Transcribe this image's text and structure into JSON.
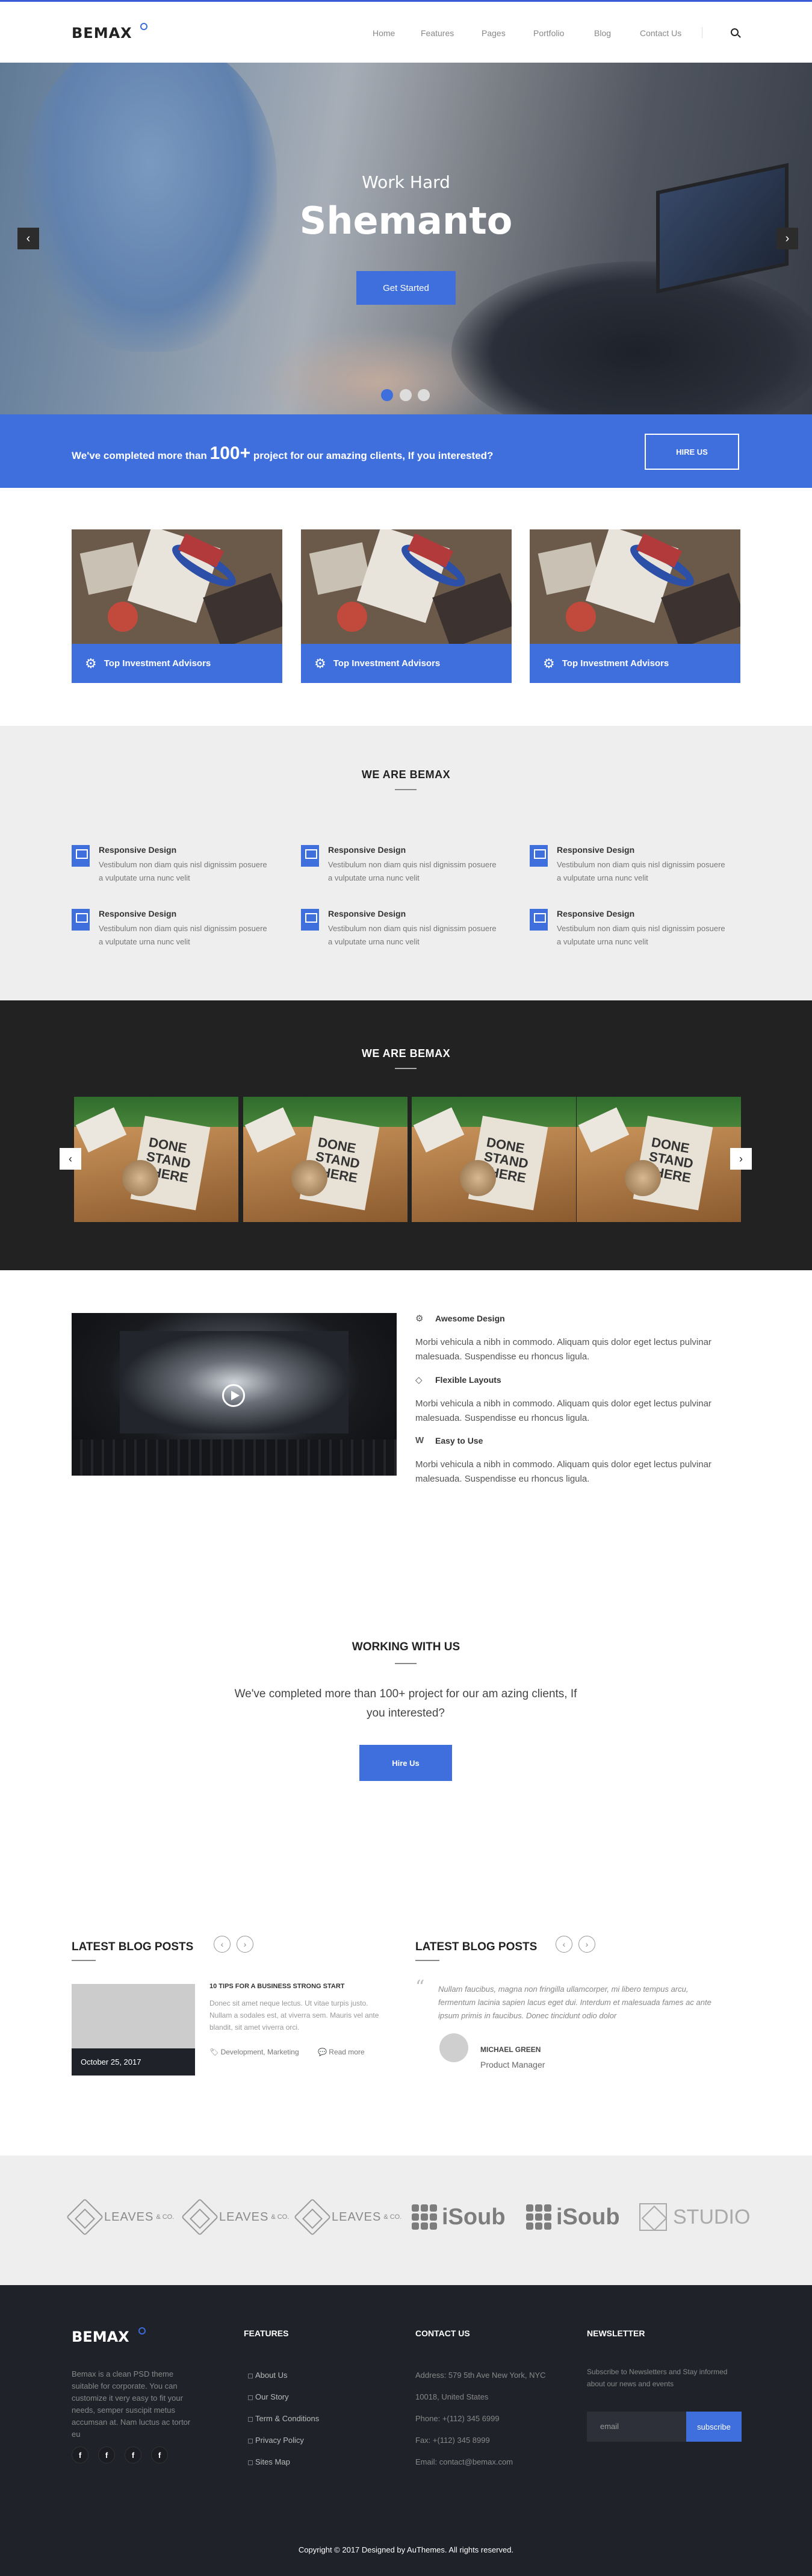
{
  "brand": {
    "logo": "BEMAX",
    "accent": "#3f6fdc"
  },
  "nav": {
    "items": [
      "Home",
      "Features",
      "Pages",
      "Portfolio",
      "Blog",
      "Contact Us"
    ]
  },
  "hero": {
    "subtitle": "Work Hard",
    "title": "Shemanto",
    "button": "Get Started",
    "prev": "‹",
    "next": "›"
  },
  "cta": {
    "text_before": "We've completed more than ",
    "number": "100+",
    "text_after": " project for our amazing clients, If you interested?",
    "button": "HIRE US"
  },
  "cards": [
    {
      "title": "Top Investment Advisors"
    },
    {
      "title": "Top Investment Advisors"
    },
    {
      "title": "Top Investment Advisors"
    }
  ],
  "features": {
    "title": "WE ARE BEMAX",
    "items": [
      {
        "title": "Responsive Design",
        "text": "Vestibulum non diam quis nisl dignissim posuere a vulputate urna nunc velit"
      },
      {
        "title": "Responsive Design",
        "text": "Vestibulum non diam quis nisl dignissim posuere a vulputate urna nunc velit"
      },
      {
        "title": "Responsive Design",
        "text": "Vestibulum non diam quis nisl dignissim posuere a vulputate urna nunc velit"
      },
      {
        "title": "Responsive Design",
        "text": "Vestibulum non diam quis nisl dignissim posuere a vulputate urna nunc velit"
      },
      {
        "title": "Responsive Design",
        "text": "Vestibulum non diam quis nisl dignissim posuere a vulputate urna nunc velit"
      },
      {
        "title": "Responsive Design",
        "text": "Vestibulum non diam quis nisl dignissim posuere a vulputate urna nunc velit"
      }
    ]
  },
  "gallery": {
    "title": "WE ARE BEMAX",
    "book_text": "DONE STAND THERE",
    "prev": "‹",
    "next": "›"
  },
  "video_features": [
    {
      "title": "Awesome Design",
      "icon": "gears-icon",
      "text": "Morbi vehicula a nibh in commodo. Aliquam quis dolor eget lectus pulvinar malesuada. Suspendisse eu rhoncus ligula."
    },
    {
      "title": "Flexible Layouts",
      "icon": "diamond-icon",
      "text": "Morbi vehicula a nibh in commodo. Aliquam quis dolor eget lectus pulvinar malesuada. Suspendisse eu rhoncus ligula."
    },
    {
      "title": "Easy to Use",
      "icon": "w-icon",
      "text": "Morbi vehicula a nibh in commodo. Aliquam quis dolor eget lectus pulvinar malesuada. Suspendisse eu rhoncus ligula."
    }
  ],
  "working": {
    "title": "WORKING WITH US",
    "text": "We've completed more than 100+ project for our am azing clients, If you interested?",
    "button": "Hire Us"
  },
  "blog": {
    "heading_left": "LATEST BLOG POSTS",
    "heading_right": "LATEST BLOG POSTS",
    "post": {
      "date": "October 25, 2017",
      "title": "10 TIPS FOR A BUSINESS STRONG START",
      "text": "Donec sit amet neque lectus. Ut vitae turpis justo. Nullam a sodales est, at viverra sem. Mauris vel ante blandit, sit amet viverra orci.",
      "tags": "Development, Marketing",
      "comments": "Read more"
    },
    "testimonial": {
      "quote": "Nullam faucibus, magna non fringilla ullamcorper, mi libero tempus arcu, fermentum lacinia sapien lacus eget dui. Interdum et malesuada fames ac ante ipsum primis in faucibus. Donec tincidunt odio dolor",
      "name": "MICHAEL GREEN",
      "role": "Product Manager"
    }
  },
  "partners": [
    {
      "name": "LEAVES",
      "suffix": "& CO."
    },
    {
      "name": "LEAVES",
      "suffix": "& CO."
    },
    {
      "name": "LEAVES",
      "suffix": "& CO."
    },
    {
      "name": "iSoub"
    },
    {
      "name": "iSoub"
    },
    {
      "name": "STUDIO"
    }
  ],
  "footer": {
    "logo": "BEMAX",
    "about": "Bemax is a clean PSD theme suitable for corporate. You can customize it very easy to fit your needs, semper suscipit metus accumsan at. Nam luctus ac tortor eu",
    "social": [
      "f",
      "f",
      "f",
      "f"
    ],
    "features_title": "FEATURES",
    "links": [
      "About Us",
      "Our Story",
      "Term & Conditions",
      "Privacy Policy",
      "Sites Map"
    ],
    "contact_title": "CONTACT US",
    "contact": [
      "Address: 579 5th Ave New York, NYC",
      "10018, United States",
      "Phone: +(112) 345 6999",
      "Fax: +(112) 345 8999",
      "Email: contact@bemax.com"
    ],
    "newsletter_title": "NEWSLETTER",
    "newsletter_text": "Subscribe to Newsletters and Stay informed about our news and events",
    "email_placeholder": "email",
    "subscribe": "subscribe",
    "copyright": "Copyright © 2017 Designed by AuThemes. All rights reserved."
  }
}
